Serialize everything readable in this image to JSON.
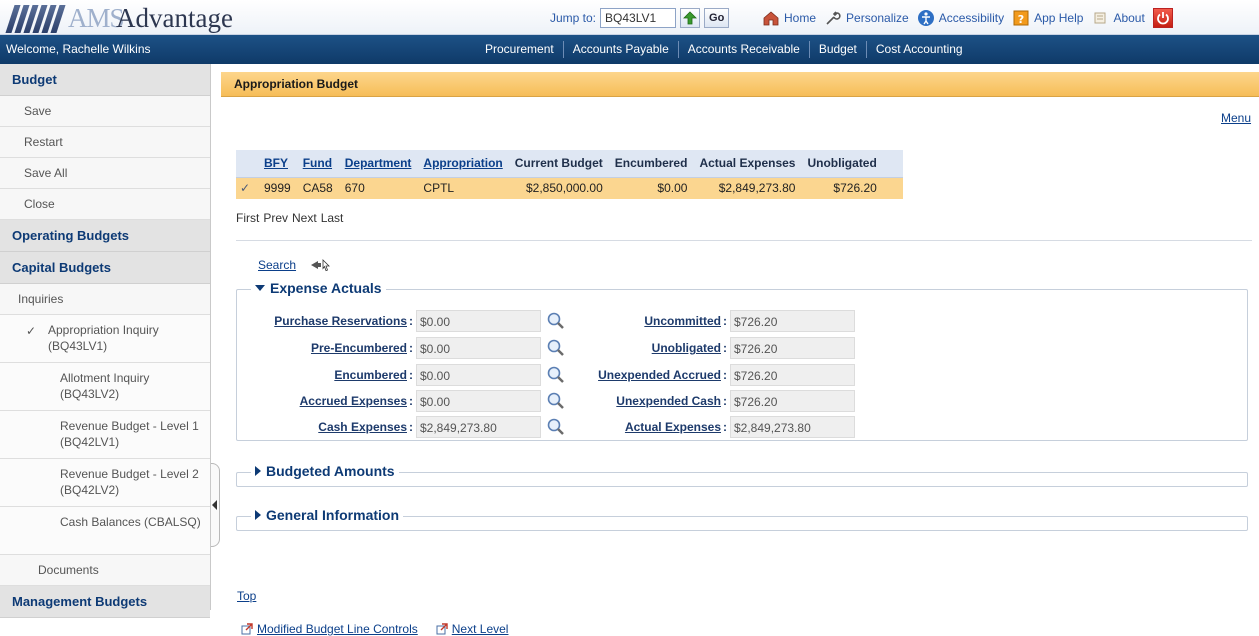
{
  "app": {
    "logo_ams": "AMS",
    "logo_advantage": "Advantage",
    "jump_label": "Jump to:",
    "jump_value": "BQ43LV1",
    "go_label": "Go",
    "top_links": [
      "Home",
      "Personalize",
      "Accessibility",
      "App Help",
      "About"
    ]
  },
  "nav": {
    "welcome": "Welcome, Rachelle Wilkins",
    "modules": [
      "Procurement",
      "Accounts Payable",
      "Accounts Receivable",
      "Budget",
      "Cost Accounting"
    ]
  },
  "sidebar": {
    "budget_header": "Budget",
    "actions": [
      "Save",
      "Restart",
      "Save All",
      "Close"
    ],
    "operating": "Operating Budgets",
    "capital": "Capital Budgets",
    "inquiries": "Inquiries",
    "inquiry_items": [
      {
        "label": "Appropriation Inquiry (BQ43LV1)",
        "current": true
      },
      {
        "label": "Allotment Inquiry (BQ43LV2)",
        "current": false
      },
      {
        "label": "Revenue Budget - Level 1 (BQ42LV1)",
        "current": false
      },
      {
        "label": "Revenue Budget - Level 2 (BQ42LV2)",
        "current": false
      },
      {
        "label": "Cash Balances (CBALSQ)",
        "current": false
      }
    ],
    "documents": "Documents",
    "management": "Management Budgets"
  },
  "page": {
    "title": "Appropriation Budget",
    "menu_link": "Menu",
    "pager": [
      "First",
      "Prev",
      "Next",
      "Last"
    ],
    "search_link": "Search",
    "top_link": "Top",
    "bottom_links": [
      "Modified Budget Line Controls",
      "Next Level"
    ]
  },
  "grid": {
    "headers": [
      "BFY",
      "Fund",
      "Department",
      "Appropriation",
      "Current Budget",
      "Encumbered",
      "Actual Expenses",
      "Unobligated"
    ],
    "row": [
      "9999",
      "CA58",
      "670",
      "CPTL",
      "$2,850,000.00",
      "$0.00",
      "$2,849,273.80",
      "$726.20"
    ]
  },
  "expense_actuals": {
    "title": "Expense Actuals",
    "left": [
      {
        "label": "Purchase Reservations",
        "value": "$0.00"
      },
      {
        "label": "Pre-Encumbered",
        "value": "$0.00"
      },
      {
        "label": "Encumbered",
        "value": "$0.00"
      },
      {
        "label": "Accrued Expenses",
        "value": "$0.00"
      },
      {
        "label": "Cash Expenses",
        "value": "$2,849,273.80"
      }
    ],
    "right": [
      {
        "label": "Uncommitted",
        "value": "$726.20"
      },
      {
        "label": "Unobligated",
        "value": "$726.20"
      },
      {
        "label": "Unexpended Accrued",
        "value": "$726.20"
      },
      {
        "label": "Unexpended Cash",
        "value": "$726.20"
      },
      {
        "label": "Actual Expenses",
        "value": "$2,849,273.80"
      }
    ]
  },
  "sections": {
    "budgeted_amounts": "Budgeted Amounts",
    "general_information": "General Information"
  }
}
